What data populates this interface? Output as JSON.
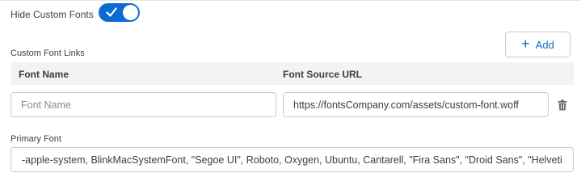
{
  "toggle": {
    "label": "Hide Custom Fonts",
    "checked": true,
    "icon": "checkmark-icon",
    "color": "#0b6bd3"
  },
  "custom_fonts": {
    "section_label": "Custom Font Links",
    "add_button": {
      "icon": "plus-icon",
      "icon_glyph": "+",
      "label": "Add"
    },
    "columns": {
      "name": "Font Name",
      "url": "Font Source URL"
    },
    "rows": [
      {
        "name_value": "",
        "name_placeholder": "Font Name",
        "url_value": "https://fontsCompany.com/assets/custom-font.woff",
        "delete_icon": "trash-icon"
      }
    ]
  },
  "primary_font": {
    "label": "Primary Font",
    "value": "-apple-system, BlinkMacSystemFont, \"Segoe UI\", Roboto, Oxygen, Ubuntu, Cantarell, \"Fira Sans\", \"Droid Sans\", \"Helvetica Neue\", sans-serif"
  },
  "colors": {
    "accent": "#0b6bd3",
    "border": "#c9c9c9",
    "header_bg": "#f3f3f3"
  }
}
